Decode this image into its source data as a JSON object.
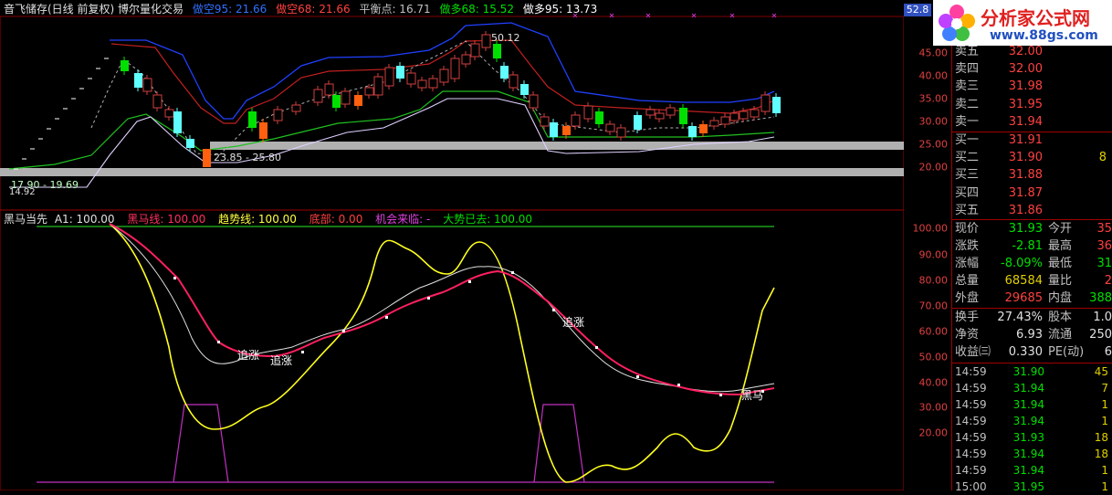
{
  "header": {
    "title": "音飞储存(日线 前复权) 博尔量化交易",
    "indicators": [
      {
        "label": "做空95: 21.66",
        "color": "#3070ff"
      },
      {
        "label": "做空68: 21.66",
        "color": "#ff4040"
      },
      {
        "label": "平衡点: 16.71",
        "color": "#c0c0c0"
      },
      {
        "label": "做多68: 15.52",
        "color": "#00e000"
      },
      {
        "label": "做多95: 13.73",
        "color": "#ffffff"
      }
    ]
  },
  "annotations_top": {
    "high_label": "50.12",
    "band1_label": "23.85 - 25.80",
    "band2_label": "17.90 - 19.69",
    "low_label": "14.92"
  },
  "subchart_header": {
    "name": "黑马当先",
    "items": [
      {
        "label": "A1: 100.00",
        "color": "#e0e0e0"
      },
      {
        "label": "黑马线: 100.00",
        "color": "#ff3060"
      },
      {
        "label": "趋势线: 100.00",
        "color": "#ffff40"
      },
      {
        "label": "底部: 0.00",
        "color": "#ff4040"
      },
      {
        "label": "机会来临: -",
        "color": "#e040e0"
      },
      {
        "label": "大势已去: 100.00",
        "color": "#00e000"
      }
    ]
  },
  "annotations_bottom": [
    "追涨",
    "追涨",
    "追涨",
    "黑马"
  ],
  "axis_top": {
    "current": "52.8",
    "ticks": [
      "5",
      "45.00",
      "40.00",
      "35.00",
      "30.00",
      "25.00",
      "20.00"
    ]
  },
  "axis_bottom": {
    "ticks": [
      "100.00",
      "90.00",
      "80.00",
      "70.00",
      "60.00",
      "50.00",
      "40.00",
      "30.00",
      "20.00"
    ]
  },
  "logo": {
    "text": "分析家公式网",
    "url_text": "www.88gs.com"
  },
  "order_book": {
    "asks": [
      {
        "label": "卖五",
        "price": "32.00"
      },
      {
        "label": "卖四",
        "price": "32.00"
      },
      {
        "label": "卖三",
        "price": "31.98"
      },
      {
        "label": "卖二",
        "price": "31.95"
      },
      {
        "label": "卖一",
        "price": "31.94"
      }
    ],
    "bids": [
      {
        "label": "买一",
        "price": "31.91"
      },
      {
        "label": "买二",
        "price": "31.90"
      },
      {
        "label": "买三",
        "price": "31.88"
      },
      {
        "label": "买四",
        "price": "31.87"
      },
      {
        "label": "买五",
        "price": "31.86"
      }
    ],
    "bid_sizes": [
      "",
      "8",
      "",
      "",
      ""
    ]
  },
  "quote": [
    {
      "l1": "现价",
      "v1": "31.93",
      "c1": "green",
      "l2": "今开",
      "v2": "35",
      "c2": "red"
    },
    {
      "l1": "涨跌",
      "v1": "-2.81",
      "c1": "green",
      "l2": "最高",
      "v2": "36",
      "c2": "red"
    },
    {
      "l1": "涨幅",
      "v1": "-8.09%",
      "c1": "green",
      "l2": "最低",
      "v2": "31",
      "c2": "green"
    },
    {
      "l1": "总量",
      "v1": "68584",
      "c1": "yellow",
      "l2": "量比",
      "v2": "2",
      "c2": "red"
    },
    {
      "l1": "外盘",
      "v1": "29685",
      "c1": "red",
      "l2": "内盘",
      "v2": "388",
      "c2": "green"
    }
  ],
  "fund": [
    {
      "l1": "换手",
      "v1": "27.43%",
      "l2": "股本",
      "v2": "1.0"
    },
    {
      "l1": "净资",
      "v1": "6.93",
      "l2": "流通",
      "v2": "250"
    },
    {
      "l1": "收益㈢",
      "v1": "0.330",
      "l2": "PE(动)",
      "v2": "6"
    }
  ],
  "ticks": [
    {
      "time": "14:59",
      "price": "31.90",
      "vol": "45"
    },
    {
      "time": "14:59",
      "price": "31.94",
      "vol": "7"
    },
    {
      "time": "14:59",
      "price": "31.94",
      "vol": "1"
    },
    {
      "time": "14:59",
      "price": "31.94",
      "vol": "1"
    },
    {
      "time": "14:59",
      "price": "31.93",
      "vol": "18"
    },
    {
      "time": "14:59",
      "price": "31.94",
      "vol": "18"
    },
    {
      "time": "14:59",
      "price": "31.94",
      "vol": "1"
    },
    {
      "time": "15:00",
      "price": "31.95",
      "vol": "1"
    }
  ]
}
